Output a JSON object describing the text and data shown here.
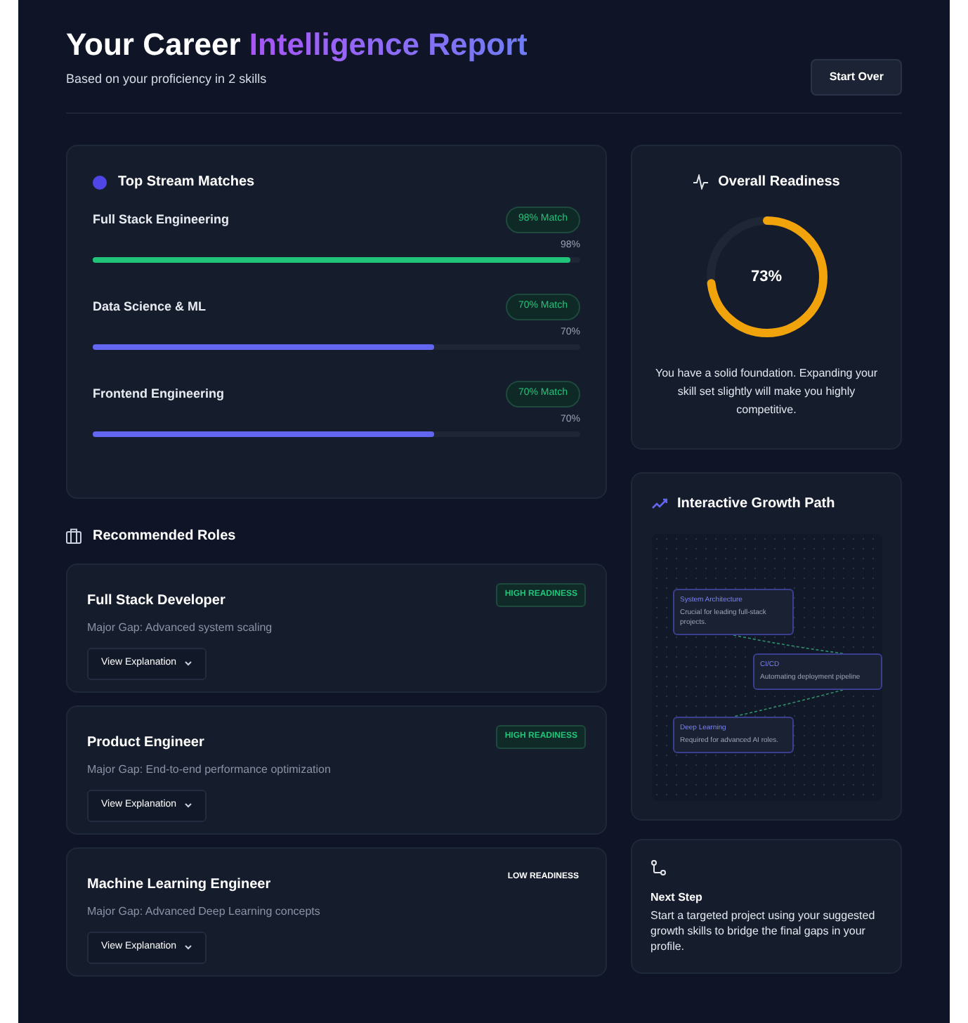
{
  "header": {
    "title_plain": "Your Career",
    "title_accent": "Intelligence Report",
    "subtitle": "Based on your proficiency in 2 skills",
    "button": "Start Over"
  },
  "stream_matches": {
    "title": "Top Stream Matches",
    "items": [
      {
        "name": "Full Stack Engineering",
        "badge": "98% Match",
        "reading": "98%",
        "level": 0.98,
        "color": "#22c47a"
      },
      {
        "name": "Data Science & ML",
        "badge": "70% Match",
        "reading": "70%",
        "level": 0.7,
        "color": "#6366f1"
      },
      {
        "name": "Frontend Engineering",
        "badge": "70% Match",
        "reading": "70%",
        "level": 0.7,
        "color": "#6366f1"
      }
    ]
  },
  "roles": {
    "title": "Recommended Roles",
    "items": [
      {
        "title": "Full Stack Developer",
        "gap": "Major Gap: Advanced system scaling",
        "badge": "HIGH READINESS",
        "kind": "high",
        "button": "View Explanation"
      },
      {
        "title": "Product Engineer",
        "gap": "Major Gap: End-to-end performance optimization",
        "badge": "HIGH READINESS",
        "kind": "high",
        "button": "View Explanation"
      },
      {
        "title": "Machine Learning Engineer",
        "gap": "Major Gap: Advanced Deep Learning concepts",
        "badge": "LOW READINESS",
        "kind": "low",
        "button": "View Explanation"
      }
    ]
  },
  "readiness": {
    "title": "Overall Readiness",
    "reading": "73%",
    "level": 0.73,
    "text": "You have a solid foundation. Expanding your skill set slightly will make you highly competitive."
  },
  "growth_path": {
    "title": "Interactive Growth Path",
    "nodes": [
      {
        "title": "System Architecture",
        "description": "Crucial for leading full-stack projects."
      },
      {
        "title": "CI/CD",
        "description": "Automating deployment pipeline"
      },
      {
        "title": "Deep Learning",
        "description": "Required for advanced AI roles."
      }
    ]
  },
  "next_step": {
    "title": "Next Step",
    "text": "Start a targeted project using your suggested growth skills to bridge the final gaps in your profile."
  }
}
